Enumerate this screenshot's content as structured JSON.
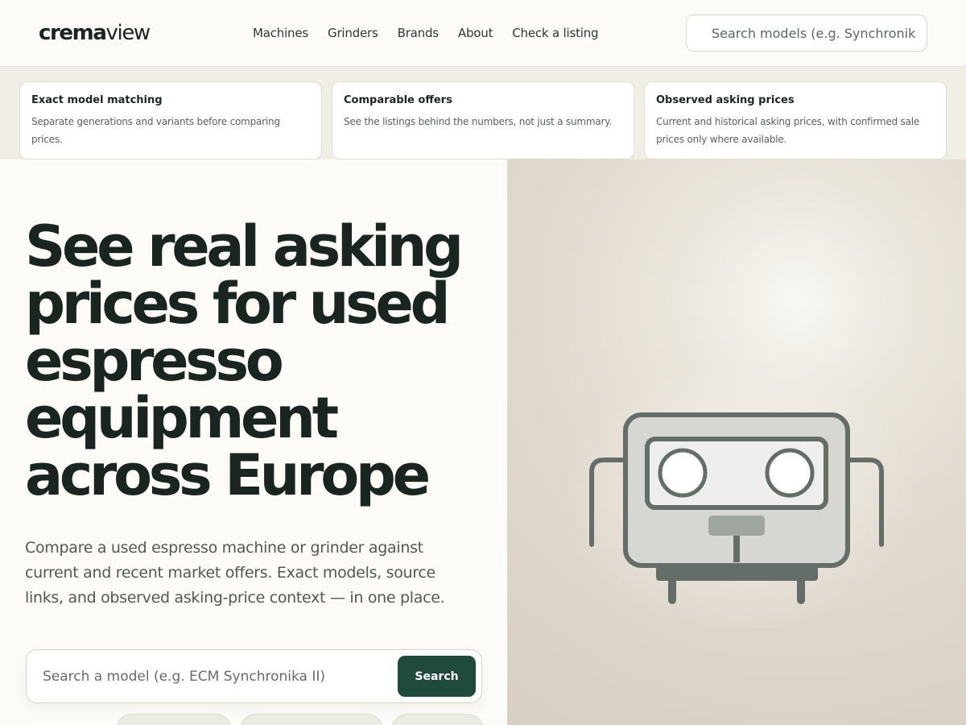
{
  "header": {
    "logo_bold": "crema",
    "logo_light": "view",
    "nav": [
      "Machines",
      "Grinders",
      "Brands",
      "About",
      "Check a listing"
    ],
    "search_placeholder": "Search models (e.g. Synchronika, Mythos)"
  },
  "features": [
    {
      "title": "Exact model matching",
      "desc": "Separate generations and variants before comparing prices."
    },
    {
      "title": "Comparable offers",
      "desc": "See the listings behind the numbers, not just a summary."
    },
    {
      "title": "Observed asking prices",
      "desc": "Current and historical asking prices, with confirmed sale prices only where available."
    }
  ],
  "hero": {
    "title": "See real asking prices for used espresso equipment across Europe",
    "subtitle": "Compare a used espresso machine or grinder against current and recent market offers. Exact models, source links, and observed asking-price context — in one place.",
    "search_placeholder": "Search a model (e.g. ECM Synchronika II)",
    "search_button": "Search",
    "illustration_icon": "espresso-machine-icon",
    "colors": {
      "accent": "#1f4a3c",
      "heading": "#1a2420",
      "machine_stroke": "#656d68"
    }
  }
}
